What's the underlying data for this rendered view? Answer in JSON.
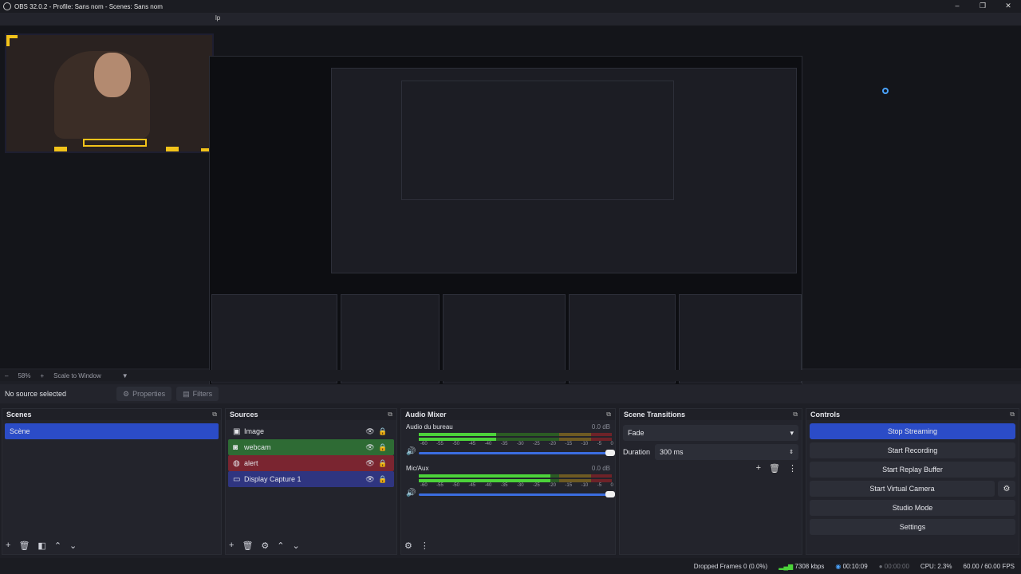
{
  "window": {
    "title": "OBS 32.0.2 - Profile: Sans nom - Scenes: Sans nom",
    "menu_fragment": "lp"
  },
  "window_controls": {
    "minimize": "–",
    "maximize": "❐",
    "close": "✕"
  },
  "zoom": {
    "minus": "–",
    "value": "58%",
    "plus": "+",
    "mode": "Scale to Window",
    "dropdown": "▼"
  },
  "source_bar": {
    "no_source": "No source selected",
    "properties": "Properties",
    "filters": "Filters"
  },
  "scenes": {
    "title": "Scenes",
    "items": [
      {
        "label": "Scène",
        "selected": true
      }
    ]
  },
  "sources": {
    "title": "Sources",
    "items": [
      {
        "label": "Image",
        "icon": "image-icon",
        "color": "#23242c"
      },
      {
        "label": "webcam",
        "icon": "camera-icon",
        "color": "#2e6b34"
      },
      {
        "label": "alert",
        "icon": "browser-icon",
        "color": "#7a2530"
      },
      {
        "label": "Display Capture 1",
        "icon": "monitor-icon",
        "color": "#2f3580"
      }
    ]
  },
  "mixer": {
    "title": "Audio Mixer",
    "channels": [
      {
        "name": "Audio du bureau",
        "db": "0.0 dB",
        "level": 0.4
      },
      {
        "name": "Mic/Aux",
        "db": "0.0 dB",
        "level": 0.68
      }
    ],
    "ticks": [
      "-60",
      "-55",
      "-50",
      "-45",
      "-40",
      "-35",
      "-30",
      "-25",
      "-20",
      "-15",
      "-10",
      "-5",
      "0"
    ]
  },
  "transitions": {
    "title": "Scene Transitions",
    "selected": "Fade",
    "duration_label": "Duration",
    "duration_value": "300 ms"
  },
  "controls": {
    "title": "Controls",
    "stop_streaming": "Stop Streaming",
    "start_recording": "Start Recording",
    "start_replay": "Start Replay Buffer",
    "start_virtual_cam": "Start Virtual Camera",
    "studio_mode": "Studio Mode",
    "settings": "Settings"
  },
  "status": {
    "dropped_frames": "Dropped Frames 0 (0.0%)",
    "bitrate": "7308 kbps",
    "stream_time": "00:10:09",
    "rec_time": "00:00:00",
    "cpu": "CPU: 2.3%",
    "fps": "60.00 / 60.00 FPS"
  },
  "colors": {
    "accent": "#2b4cc7",
    "meter_green": "#4cd33a",
    "meter_yellow": "#e0a62a",
    "meter_red": "#c8323a"
  }
}
